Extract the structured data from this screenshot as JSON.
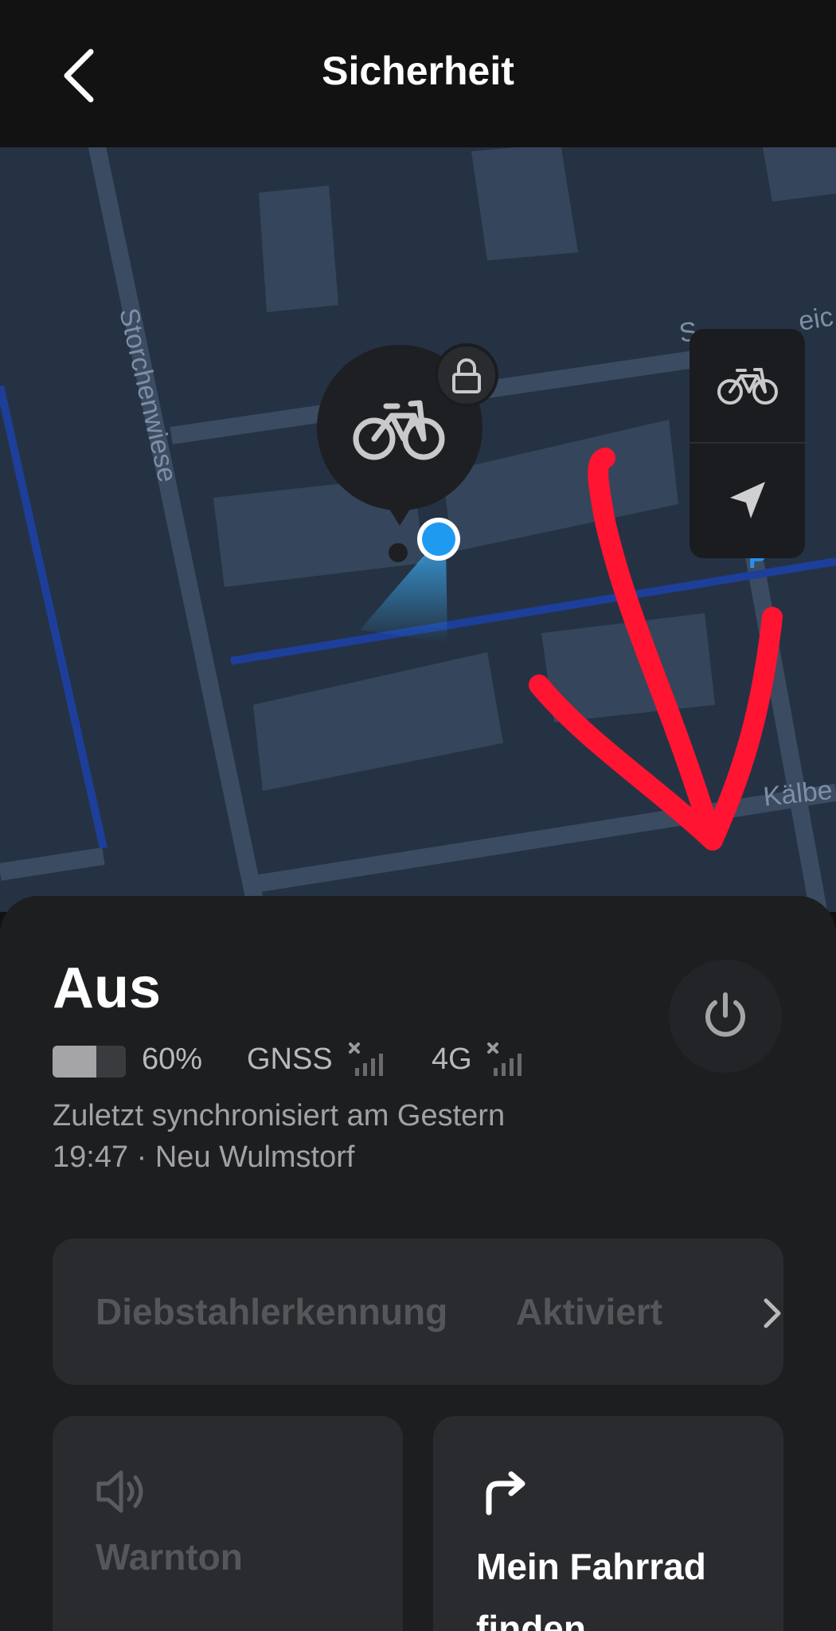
{
  "header": {
    "title": "Sicherheit"
  },
  "map": {
    "street_labels": [
      "Storchenwiese",
      "Kälbe",
      "S",
      "eic"
    ],
    "parking_label": "P",
    "bike_locked": true
  },
  "status": {
    "title": "Aus",
    "battery_percent": 60,
    "battery_text": "60%",
    "gnss_label": "GNSS",
    "gnss_signal": "none",
    "lte_label": "4G",
    "lte_signal": "none",
    "sync_line1": "Zuletzt synchronisiert am Gestern",
    "sync_line2": "19:47 · Neu Wulmstorf"
  },
  "theft_detection": {
    "label": "Diebstahlerkennung",
    "value": "Aktiviert"
  },
  "tiles": {
    "alarm": {
      "label": "Warnton",
      "icon": "speaker-icon"
    },
    "find": {
      "label": "Mein Fahrrad finden",
      "icon": "turn-right-arrow-icon"
    }
  },
  "colors": {
    "background": "#121212",
    "map_background": "#253244",
    "panel": "#1d1e20",
    "location_dot": "#1e9bf0",
    "annotation_arrow": "#ff1432"
  }
}
